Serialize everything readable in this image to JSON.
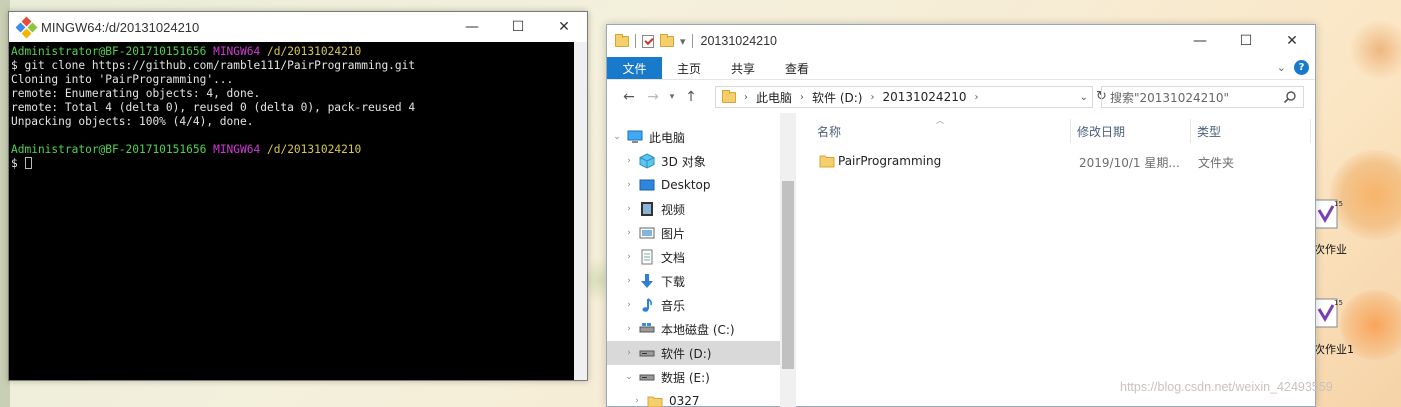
{
  "colors": {
    "ribbon_file_tab": "#1979ca",
    "selected_row": "#d9d9d9",
    "terminal_bg": "#000000",
    "prompt_user": "#4fd34f",
    "prompt_host": "#d23ad2",
    "prompt_path": "#d9c84a",
    "folder_yellow": "#f5cf6a"
  },
  "terminal": {
    "title": "MINGW64:/d/20131024210",
    "prompt1": {
      "user": "Administrator@BF-201710151656",
      "host": "MINGW64",
      "path": "/d/20131024210"
    },
    "lines": [
      "$ git clone https://github.com/ramble111/PairProgramming.git",
      "Cloning into 'PairProgramming'...",
      "remote: Enumerating objects: 4, done.",
      "remote: Total 4 (delta 0), reused 0 (delta 0), pack-reused 4",
      "Unpacking objects: 100% (4/4), done."
    ],
    "prompt2": {
      "user": "Administrator@BF-201710151656",
      "host": "MINGW64",
      "path": "/d/20131024210"
    },
    "dollar": "$",
    "buttons": {
      "minimize": "—",
      "maximize": "☐",
      "close": "✕"
    }
  },
  "explorer": {
    "title": "20131024210",
    "buttons": {
      "minimize": "—",
      "maximize": "☐",
      "close": "✕"
    },
    "ribbon_tabs": [
      "文件",
      "主页",
      "共享",
      "查看"
    ],
    "breadcrumbs": [
      "此电脑",
      "软件 (D:)",
      "20131024210"
    ],
    "search_placeholder": "搜索\"20131024210\"",
    "nav_items": [
      {
        "label": "此电脑",
        "icon": "computer-icon"
      },
      {
        "label": "3D 对象",
        "icon": "cube-3d-icon"
      },
      {
        "label": "Desktop",
        "icon": "desktop-icon"
      },
      {
        "label": "视频",
        "icon": "video-icon"
      },
      {
        "label": "图片",
        "icon": "picture-icon"
      },
      {
        "label": "文档",
        "icon": "document-icon"
      },
      {
        "label": "下载",
        "icon": "download-icon"
      },
      {
        "label": "音乐",
        "icon": "music-icon"
      },
      {
        "label": "本地磁盘 (C:)",
        "icon": "drive-icon"
      },
      {
        "label": "软件 (D:)",
        "icon": "drive-icon"
      },
      {
        "label": "数据 (E:)",
        "icon": "drive-icon"
      },
      {
        "label": "0327",
        "icon": "folder-icon"
      }
    ],
    "columns": {
      "name": "名称",
      "date": "修改日期",
      "type": "类型"
    },
    "files": [
      {
        "name": "PairProgramming",
        "date": "2019/10/1 星期...",
        "type": "文件夹"
      }
    ]
  },
  "desktop": {
    "icon_labels": [
      "次作业",
      "次作业1"
    ],
    "watermark": "https://blog.csdn.net/weixin_42493559"
  }
}
